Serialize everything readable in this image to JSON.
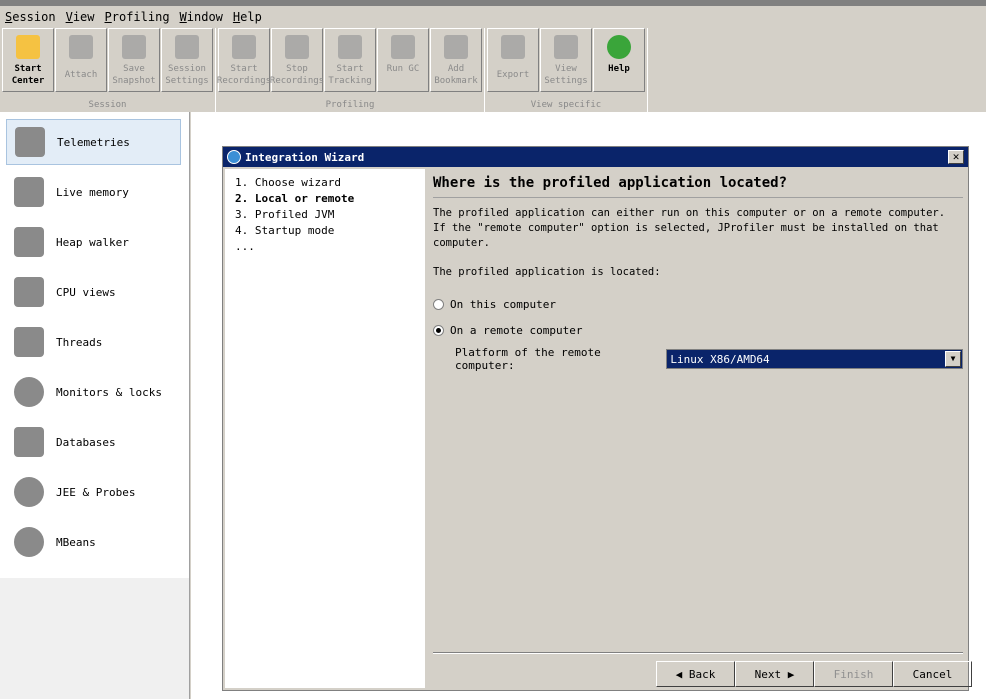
{
  "menu": [
    "Session",
    "View",
    "Profiling",
    "Window",
    "Help"
  ],
  "toolbar": {
    "groups": [
      {
        "label": "Session",
        "buttons": [
          {
            "label": "Start Center",
            "enabled": true,
            "icon": "folder-play-icon"
          },
          {
            "label": "Attach",
            "enabled": false,
            "icon": "plug-icon"
          },
          {
            "label": "Save Snapshot",
            "enabled": false,
            "icon": "floppy-icon"
          },
          {
            "label": "Session Settings",
            "enabled": false,
            "icon": "clipboard-icon"
          }
        ]
      },
      {
        "label": "Profiling",
        "buttons": [
          {
            "label": "Start Recordings",
            "enabled": false,
            "icon": "film-reel-icon"
          },
          {
            "label": "Stop Recordings",
            "enabled": false,
            "icon": "film-reel-stop-icon"
          },
          {
            "label": "Start Tracking",
            "enabled": false,
            "icon": "tracking-icon"
          },
          {
            "label": "Run GC",
            "enabled": false,
            "icon": "recycle-icon"
          },
          {
            "label": "Add Bookmark",
            "enabled": false,
            "icon": "bookmark-icon"
          }
        ]
      },
      {
        "label": "View specific",
        "buttons": [
          {
            "label": "Export",
            "enabled": false,
            "icon": "export-icon"
          },
          {
            "label": "View Settings",
            "enabled": false,
            "icon": "view-settings-icon"
          },
          {
            "label": "Help",
            "enabled": true,
            "icon": "help-icon"
          }
        ]
      }
    ]
  },
  "sidebar": {
    "items": [
      {
        "label": "Telemetries",
        "icon": "telemetries-icon",
        "selected": true
      },
      {
        "label": "Live memory",
        "icon": "live-memory-icon"
      },
      {
        "label": "Heap walker",
        "icon": "camera-icon"
      },
      {
        "label": "CPU views",
        "icon": "cpu-icon"
      },
      {
        "label": "Threads",
        "icon": "threads-icon"
      },
      {
        "label": "Monitors & locks",
        "icon": "lock-icon"
      },
      {
        "label": "Databases",
        "icon": "database-icon"
      },
      {
        "label": "JEE & Probes",
        "icon": "gauge-icon"
      },
      {
        "label": "MBeans",
        "icon": "globe-icon"
      }
    ]
  },
  "dialog": {
    "title": "Integration Wizard",
    "steps": [
      "1. Choose wizard",
      "2. Local or remote",
      "3. Profiled JVM",
      "4. Startup mode",
      "..."
    ],
    "current_step": 1,
    "heading": "Where is the profiled application located?",
    "description": "The profiled application can either run on this computer or on a remote computer. If the \"remote computer\" option is selected, JProfiler must be installed on that computer.",
    "located_label": "The profiled application is located:",
    "options": [
      {
        "label": "On this computer",
        "selected": false
      },
      {
        "label": "On a remote computer",
        "selected": true
      }
    ],
    "platform_label": "Platform of the remote computer:",
    "platform_value": "Linux X86/AMD64",
    "buttons": {
      "back": "Back",
      "next": "Next",
      "finish": "Finish",
      "cancel": "Cancel"
    }
  }
}
